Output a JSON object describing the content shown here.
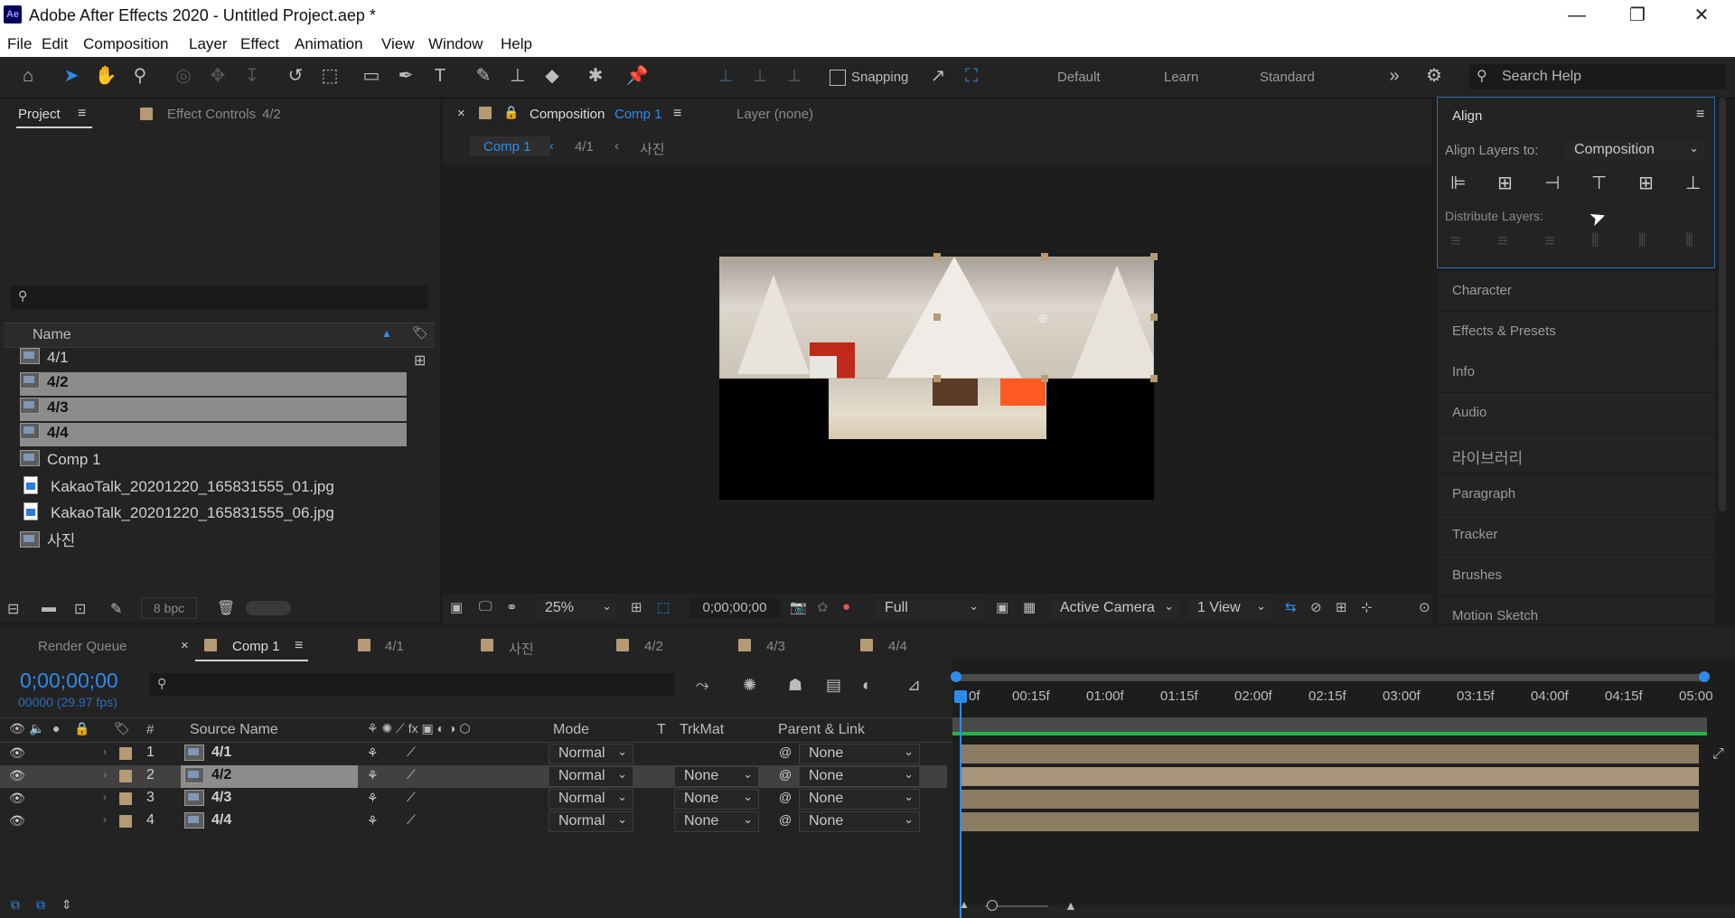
{
  "window": {
    "title": "Adobe After Effects 2020 - Untitled Project.aep *",
    "logo": "Ae",
    "minimize": "—",
    "restore": "❐",
    "close": "✕"
  },
  "menu": [
    "File",
    "Edit",
    "Composition",
    "Layer",
    "Effect",
    "Animation",
    "View",
    "Window",
    "Help"
  ],
  "toolbar": {
    "snapping_label": "Snapping",
    "workspaces": [
      "Default",
      "Learn",
      "Standard"
    ],
    "search_placeholder": "Search Help",
    "icons": [
      "home-icon",
      "selection-tool-icon",
      "hand-tool-icon",
      "zoom-tool-icon",
      "orbit-camera-icon",
      "pan-camera-icon",
      "dolly-camera-icon",
      "rotate-tool-icon",
      "pan-behind-icon",
      "rectangle-tool-icon",
      "pen-tool-icon",
      "type-tool-icon",
      "brush-tool-icon",
      "clone-stamp-icon",
      "eraser-icon",
      "roto-brush-icon",
      "puppet-pin-icon"
    ]
  },
  "project_panel": {
    "tab_label": "Project",
    "effect_controls_label": "Effect Controls",
    "effect_controls_target": "4/2",
    "search_placeholder": "",
    "column_name": "Name",
    "items": [
      {
        "name": "4/1",
        "type": "comp",
        "selected": false
      },
      {
        "name": "4/2",
        "type": "comp",
        "selected": true
      },
      {
        "name": "4/3",
        "type": "comp",
        "selected": true
      },
      {
        "name": "4/4",
        "type": "comp",
        "selected": true
      },
      {
        "name": "Comp 1",
        "type": "comp",
        "selected": false
      },
      {
        "name": "KakaoTalk_20201220_165831555_01.jpg",
        "type": "image",
        "selected": false
      },
      {
        "name": "KakaoTalk_20201220_165831555_06.jpg",
        "type": "image",
        "selected": false
      },
      {
        "name": "사진",
        "type": "comp",
        "selected": false
      }
    ],
    "bpc": "8 bpc"
  },
  "composition_panel": {
    "tab_prefix": "Composition",
    "tab_comp": "Comp 1",
    "layer_tab": "Layer (none)",
    "breadcrumbs": [
      "Comp 1",
      "4/1",
      "사진"
    ],
    "zoom": "25%",
    "timecode": "0;00;00;00",
    "resolution": "Full",
    "camera": "Active Camera",
    "views": "1 View"
  },
  "align_panel": {
    "title": "Align",
    "align_to_label": "Align Layers to:",
    "align_to_value": "Composition",
    "distribute_label": "Distribute Layers:"
  },
  "right_panels": [
    "Character",
    "Effects & Presets",
    "Info",
    "Audio",
    "라이브러리",
    "Paragraph",
    "Tracker",
    "Brushes",
    "Motion Sketch"
  ],
  "timeline": {
    "tabs": [
      {
        "label": "Render Queue",
        "active": false,
        "swatch": false
      },
      {
        "label": "Comp 1",
        "active": true,
        "swatch": true
      },
      {
        "label": "4/1",
        "active": false,
        "swatch": true
      },
      {
        "label": "사진",
        "active": false,
        "swatch": true
      },
      {
        "label": "4/2",
        "active": false,
        "swatch": true
      },
      {
        "label": "4/3",
        "active": false,
        "swatch": true
      },
      {
        "label": "4/4",
        "active": false,
        "swatch": true
      }
    ],
    "timecode": "0;00;00;00",
    "frames": "00000 (29.97 fps)",
    "columns": {
      "num": "#",
      "source": "Source Name",
      "mode": "Mode",
      "t": "T",
      "trkmat": "TrkMat",
      "parent": "Parent & Link"
    },
    "layers": [
      {
        "num": "1",
        "name": "4/1",
        "mode": "Normal",
        "trkmat": "",
        "parent": "None",
        "selected": false
      },
      {
        "num": "2",
        "name": "4/2",
        "mode": "Normal",
        "trkmat": "None",
        "parent": "None",
        "selected": true
      },
      {
        "num": "3",
        "name": "4/3",
        "mode": "Normal",
        "trkmat": "None",
        "parent": "None",
        "selected": false
      },
      {
        "num": "4",
        "name": "4/4",
        "mode": "Normal",
        "trkmat": "None",
        "parent": "None",
        "selected": false
      }
    ],
    "ruler": [
      "0f",
      "00:15f",
      "01:00f",
      "01:15f",
      "02:00f",
      "02:15f",
      "03:00f",
      "03:15f",
      "04:00f",
      "04:15f",
      "05:00"
    ]
  },
  "colors": {
    "accent": "#2d8ceb",
    "label_tan": "#b59a74",
    "layer_bar": "#8c7c62"
  }
}
